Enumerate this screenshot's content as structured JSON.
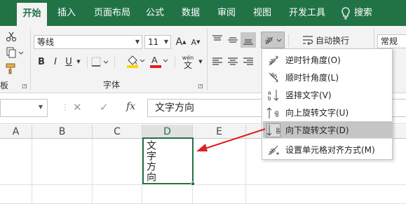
{
  "tabs": [
    {
      "label": "开始",
      "active": true
    },
    {
      "label": "插入"
    },
    {
      "label": "页面布局"
    },
    {
      "label": "公式"
    },
    {
      "label": "数据"
    },
    {
      "label": "审阅"
    },
    {
      "label": "视图"
    },
    {
      "label": "开发工具"
    },
    {
      "label": "搜索"
    }
  ],
  "ribbon": {
    "font_name": "等线",
    "font_size": "11",
    "bold": "B",
    "italic": "I",
    "underline": "U",
    "font_color_letter": "A",
    "grow_font": "A",
    "shrink_font": "A",
    "phonetic_top": "wén",
    "phonetic_bottom": "文",
    "font_group_label": "字体",
    "clipboard_group_label": "板",
    "wrap_text_label": "自动换行",
    "number_format": "常规"
  },
  "formula_bar": {
    "cancel": "✕",
    "enter": "✓",
    "fx": "fx",
    "value": "文字方向"
  },
  "grid": {
    "columns": [
      "A",
      "B",
      "C",
      "D",
      "E"
    ],
    "active_cell_text": "文字方向"
  },
  "orientation_menu": {
    "items": [
      {
        "label": "逆时针角度(O)"
      },
      {
        "label": "顺时针角度(L)"
      },
      {
        "label": "竖排文字(V)"
      },
      {
        "label": "向上旋转文字(U)"
      },
      {
        "label": "向下旋转文字(D)",
        "highlighted": true
      },
      {
        "label": "设置单元格对齐方式(M)"
      }
    ]
  },
  "colors": {
    "accent": "#217346",
    "highlight_fill": "#ffd700",
    "font_color": "#e02020",
    "arrow": "#e02020"
  }
}
